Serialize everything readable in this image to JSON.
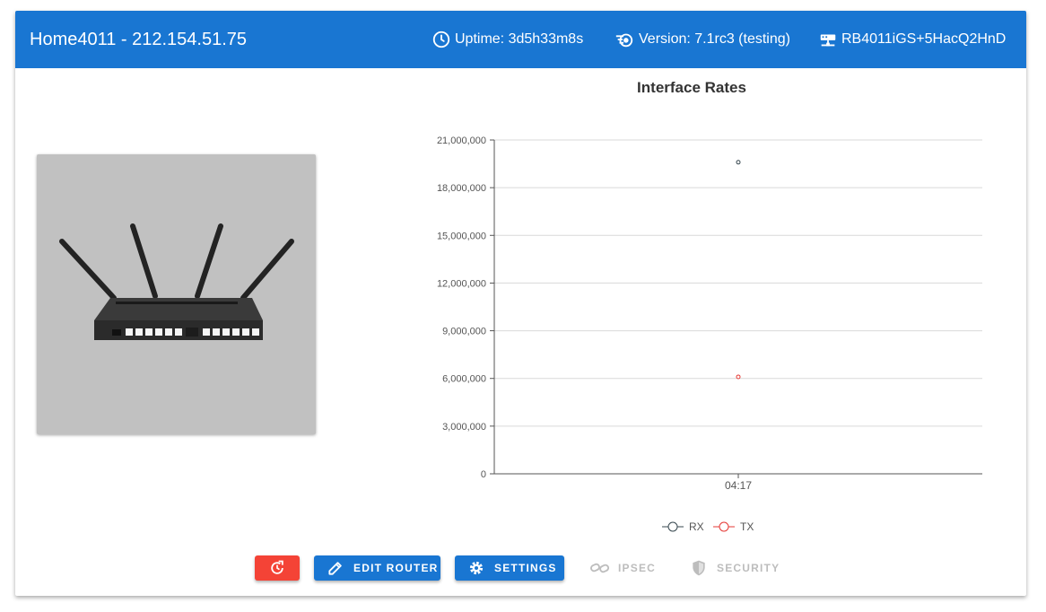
{
  "header": {
    "title": "Home4011 - 212.154.51.75",
    "uptime": "Uptime: 3d5h33m8s",
    "version": "Version: 7.1rc3 (testing)",
    "model": "RB4011iGS+5HacQ2HnD"
  },
  "colors": {
    "primary": "#1976d2",
    "danger": "#f44336",
    "disabled": "#bdbdbd"
  },
  "actions": {
    "edit_router": "EDIT ROUTER",
    "settings": "SETTINGS",
    "ipsec": "IPSEC",
    "security": "SECURITY"
  },
  "chart_data": {
    "type": "line",
    "title": "Interface Rates",
    "categories": [
      "04:17"
    ],
    "ylim": [
      0,
      21000000
    ],
    "yticks": [
      "0",
      "3,000,000",
      "6,000,000",
      "9,000,000",
      "12,000,000",
      "15,000,000",
      "18,000,000",
      "21,000,000"
    ],
    "grid": true,
    "legend_position": "bottom",
    "series": [
      {
        "name": "RX",
        "values": [
          19600000
        ],
        "color": "#37474f"
      },
      {
        "name": "TX",
        "values": [
          6100000
        ],
        "color": "#e53935"
      }
    ]
  }
}
